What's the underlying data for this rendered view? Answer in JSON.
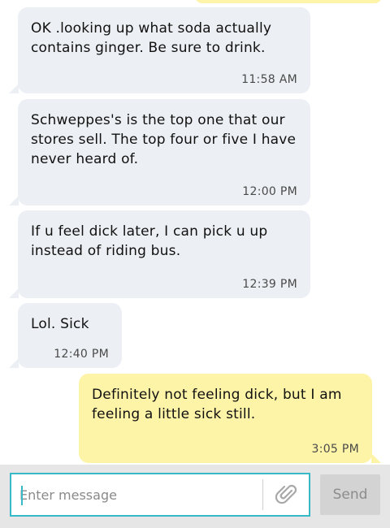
{
  "messages": [
    {
      "direction": "incoming",
      "text": "OK .looking up what soda actually\ncontains ginger. Be sure to drink.",
      "time": "11:58 AM"
    },
    {
      "direction": "incoming",
      "text": "Schweppes's is the top one that our\nstores sell. The top four or five I have\nnever heard of.",
      "time": "12:00 PM"
    },
    {
      "direction": "incoming",
      "text": "If u feel dick later, I can pick u up\ninstead of riding bus.",
      "time": "12:39 PM"
    },
    {
      "direction": "incoming",
      "text": "Lol. Sick",
      "time": "12:40 PM"
    },
    {
      "direction": "outgoing",
      "text": "Definitely not feeling dick, but I am\nfeeling a little sick still.",
      "time": "3:05 PM"
    }
  ],
  "composer": {
    "placeholder": "Enter message",
    "send_label": "Send",
    "attach_icon": "paperclip-icon"
  },
  "colors": {
    "incoming_bubble": "#eceff3",
    "outgoing_bubble": "#fdf4a7",
    "input_border": "#37b9c8",
    "composer_bg": "#e6e6e6"
  }
}
